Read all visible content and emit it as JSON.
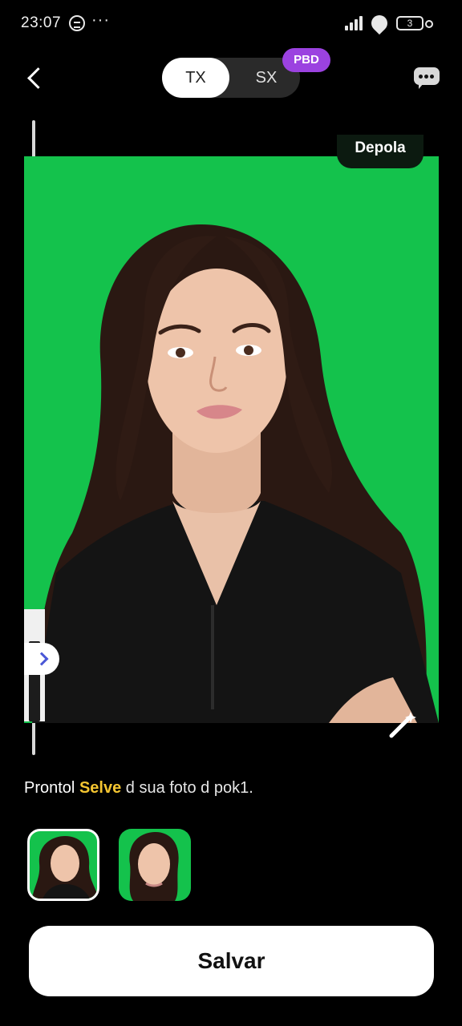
{
  "status_bar": {
    "time": "23:07",
    "overflow_dots": "···",
    "battery_level": "3"
  },
  "top_bar": {
    "tabs": [
      {
        "label": "TX",
        "selected": true
      },
      {
        "label": "SX",
        "selected": false
      }
    ],
    "pro_badge": "PBD"
  },
  "photo": {
    "after_label": "Depola",
    "background_color": "#14c24c"
  },
  "message": {
    "lead": "Prontol ",
    "highlight": "Selve",
    "rest": " d sua fo‌to d pok1."
  },
  "thumbnails": [
    {
      "label": "portrait-thumbnail-1",
      "selected": true
    },
    {
      "label": "portrait-thumbnail-2",
      "selected": false
    }
  ],
  "save_button": {
    "label": "Salvar"
  },
  "colors": {
    "accent_pro": "#9b42e0",
    "highlight": "#f4c531",
    "chroma_green": "#14c24c"
  }
}
